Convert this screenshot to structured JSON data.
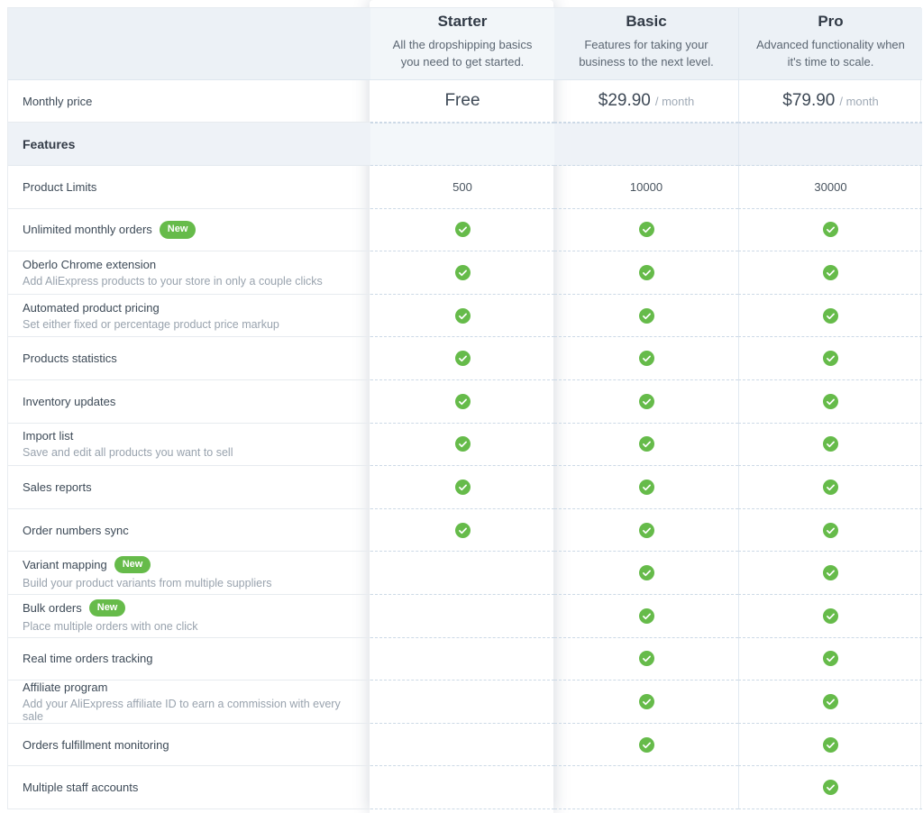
{
  "colors": {
    "green": "#66bb4a",
    "header_bg": "#ecf1f6",
    "section_bg": "#eef2f7",
    "dark_text": "#323b47",
    "muted_text": "#99a3ae"
  },
  "badge_label": "New",
  "row_labels": {
    "monthly_price": "Monthly price",
    "features_heading": "Features"
  },
  "plans": [
    {
      "name": "Starter",
      "description": "All the dropshipping basics you need to get started.",
      "price": "Free",
      "price_suffix": "",
      "highlighted": true
    },
    {
      "name": "Basic",
      "description": "Features for taking your business to the next level.",
      "price": "$29.90",
      "price_suffix": "/ month",
      "highlighted": false
    },
    {
      "name": "Pro",
      "description": "Advanced functionality when it's time to scale.",
      "price": "$79.90",
      "price_suffix": "/ month",
      "highlighted": false
    }
  ],
  "features": [
    {
      "name": "Product Limits",
      "badge": false,
      "description": "",
      "values": [
        "500",
        "10000",
        "30000"
      ]
    },
    {
      "name": "Unlimited monthly orders",
      "badge": true,
      "description": "",
      "values": [
        "check",
        "check",
        "check"
      ]
    },
    {
      "name": "Oberlo Chrome extension",
      "badge": false,
      "description": "Add AliExpress products to your store in only a couple clicks",
      "values": [
        "check",
        "check",
        "check"
      ]
    },
    {
      "name": "Automated product pricing",
      "badge": false,
      "description": "Set either fixed or percentage product price markup",
      "values": [
        "check",
        "check",
        "check"
      ]
    },
    {
      "name": "Products statistics",
      "badge": false,
      "description": "",
      "values": [
        "check",
        "check",
        "check"
      ]
    },
    {
      "name": "Inventory updates",
      "badge": false,
      "description": "",
      "values": [
        "check",
        "check",
        "check"
      ]
    },
    {
      "name": "Import list",
      "badge": false,
      "description": "Save and edit all products you want to sell",
      "values": [
        "check",
        "check",
        "check"
      ]
    },
    {
      "name": "Sales reports",
      "badge": false,
      "description": "",
      "values": [
        "check",
        "check",
        "check"
      ]
    },
    {
      "name": "Order numbers sync",
      "badge": false,
      "description": "",
      "values": [
        "check",
        "check",
        "check"
      ]
    },
    {
      "name": "Variant mapping",
      "badge": true,
      "description": "Build your product variants from multiple suppliers",
      "values": [
        "",
        "check",
        "check"
      ]
    },
    {
      "name": "Bulk orders",
      "badge": true,
      "description": "Place multiple orders with one click",
      "values": [
        "",
        "check",
        "check"
      ]
    },
    {
      "name": "Real time orders tracking",
      "badge": false,
      "description": "",
      "values": [
        "",
        "check",
        "check"
      ]
    },
    {
      "name": "Affiliate program",
      "badge": false,
      "description": "Add your AliExpress affiliate ID to earn a commission with every sale",
      "values": [
        "",
        "check",
        "check"
      ]
    },
    {
      "name": "Orders fulfillment monitoring",
      "badge": false,
      "description": "",
      "values": [
        "",
        "check",
        "check"
      ]
    },
    {
      "name": "Multiple staff accounts",
      "badge": false,
      "description": "",
      "values": [
        "",
        "",
        "check"
      ]
    }
  ]
}
